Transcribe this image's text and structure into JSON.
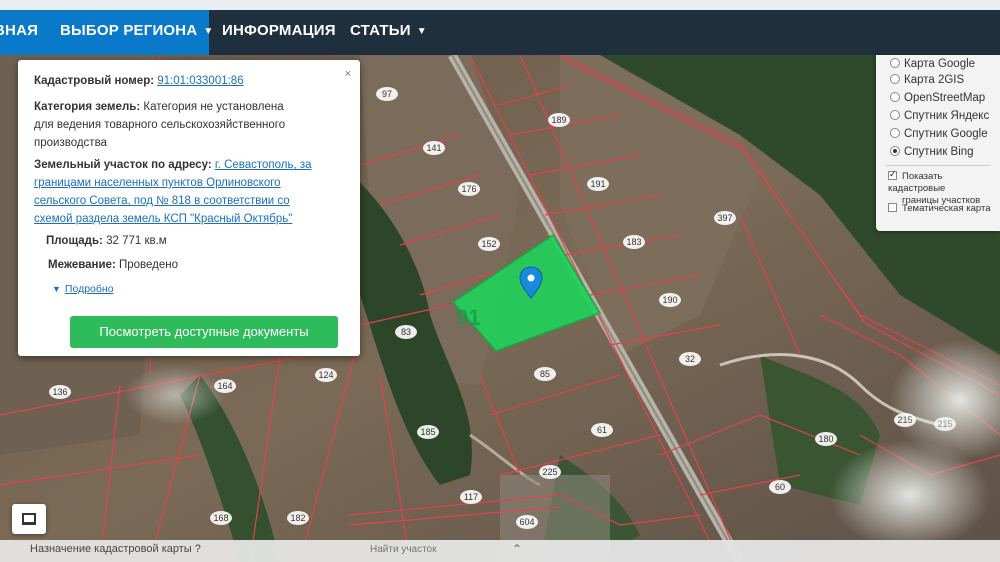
{
  "nav": {
    "home": "ВНАЯ",
    "region": "ВЫБОР РЕГИОНА",
    "info": "ИНФОРМАЦИЯ",
    "articles": "СТАТЬИ",
    "top_right_hint": "— — — — —"
  },
  "popup": {
    "cadastral_label": "Кадастровый номер:",
    "cadastral_value": "91:01:033001:86",
    "category_label": "Категория земель:",
    "category_line1": "Категория не установлена",
    "category_line2": "для ведения товарного сельскохозяйственного",
    "category_line3": "производства",
    "address_label": "Земельный участок по адресу:",
    "address_line1": "г. Севастополь, за",
    "address_line2": "границами населенных пунктов Орлиновского",
    "address_line3": "сельского Совета, под № 818 в соответствии со",
    "address_line4": "схемой раздела земель КСП \"Красный Октябрь\"",
    "area_label": "Площадь:",
    "area_value": "32 771 кв.м",
    "survey_label": "Межевание:",
    "survey_value": "Проведено",
    "more_link": "Подробно",
    "docs_button": "Посмотреть доступные документы",
    "close": "×"
  },
  "layers": {
    "options": [
      {
        "label": "Карта Google",
        "selected": false
      },
      {
        "label": "Карта 2GIS",
        "selected": false
      },
      {
        "label": "OpenStreetMap",
        "selected": false
      },
      {
        "label": "Спутник Яндекс",
        "selected": false
      },
      {
        "label": "Спутник Google",
        "selected": false
      },
      {
        "label": "Спутник Bing",
        "selected": true
      }
    ],
    "check_borders_line1": "Показать кадастровые",
    "check_borders_line2": "границы участков",
    "check_borders_checked": true,
    "check_thematic": "Тематическая карта",
    "check_thematic_checked": false
  },
  "map": {
    "selected_parcel": "91",
    "parcels": [
      "97",
      "141",
      "176",
      "189",
      "191",
      "183",
      "152",
      "397",
      "190",
      "32",
      "83",
      "85",
      "61",
      "164",
      "136",
      "124",
      "185",
      "117",
      "168",
      "182",
      "180",
      "225",
      "215",
      "215",
      "604",
      "60"
    ],
    "highlight_color": "#21d15a",
    "boundary_color": "#e2424a"
  },
  "bottom_bar": {
    "left_text": "Назначение кадастровой карты ?",
    "center_text": "Найти участок"
  },
  "colors": {
    "nav_bg": "#1f2f3d",
    "nav_active": "#0a79c9",
    "button_green": "#2ebc5a",
    "link_blue": "#1a6fc0"
  }
}
